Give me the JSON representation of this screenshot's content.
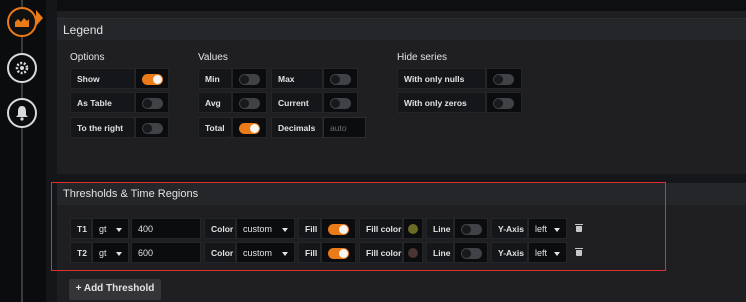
{
  "legend": {
    "title": "Legend",
    "options": {
      "title": "Options",
      "items": [
        {
          "label": "Show",
          "on": true
        },
        {
          "label": "As Table",
          "on": false
        },
        {
          "label": "To the right",
          "on": false
        }
      ]
    },
    "values": {
      "title": "Values",
      "left": [
        {
          "label": "Min",
          "on": false
        },
        {
          "label": "Avg",
          "on": false
        },
        {
          "label": "Total",
          "on": true
        }
      ],
      "right": [
        {
          "label": "Max",
          "on": false
        },
        {
          "label": "Current",
          "on": false
        }
      ],
      "decimals_label": "Decimals",
      "decimals_placeholder": "auto"
    },
    "hide_series": {
      "title": "Hide series",
      "items": [
        {
          "label": "With only nulls",
          "on": false
        },
        {
          "label": "With only zeros",
          "on": false
        }
      ]
    }
  },
  "thresholds": {
    "title": "Thresholds & Time Regions",
    "rows": [
      {
        "id": "T1",
        "op": "gt",
        "value": "400",
        "color_label": "Color",
        "color": "custom",
        "fill_label": "Fill",
        "fill_on": true,
        "fill_color_label": "Fill color",
        "fill_color": "#6b6b25",
        "line_label": "Line",
        "line_on": false,
        "yaxis_label": "Y-Axis",
        "yaxis": "left"
      },
      {
        "id": "T2",
        "op": "gt",
        "value": "600",
        "color_label": "Color",
        "color": "custom",
        "fill_label": "Fill",
        "fill_on": true,
        "fill_color_label": "Fill color",
        "fill_color": "#4a3432",
        "line_label": "Line",
        "line_on": false,
        "yaxis_label": "Y-Axis",
        "yaxis": "left"
      }
    ],
    "add_button": "+ Add Threshold"
  },
  "sidebar": {
    "items": [
      {
        "icon": "graph-icon",
        "active": true
      },
      {
        "icon": "gear-icon",
        "active": false
      },
      {
        "icon": "bell-icon",
        "active": false
      }
    ]
  },
  "colors": {
    "accent": "#eb7b18",
    "highlight": "#e02f2f"
  }
}
